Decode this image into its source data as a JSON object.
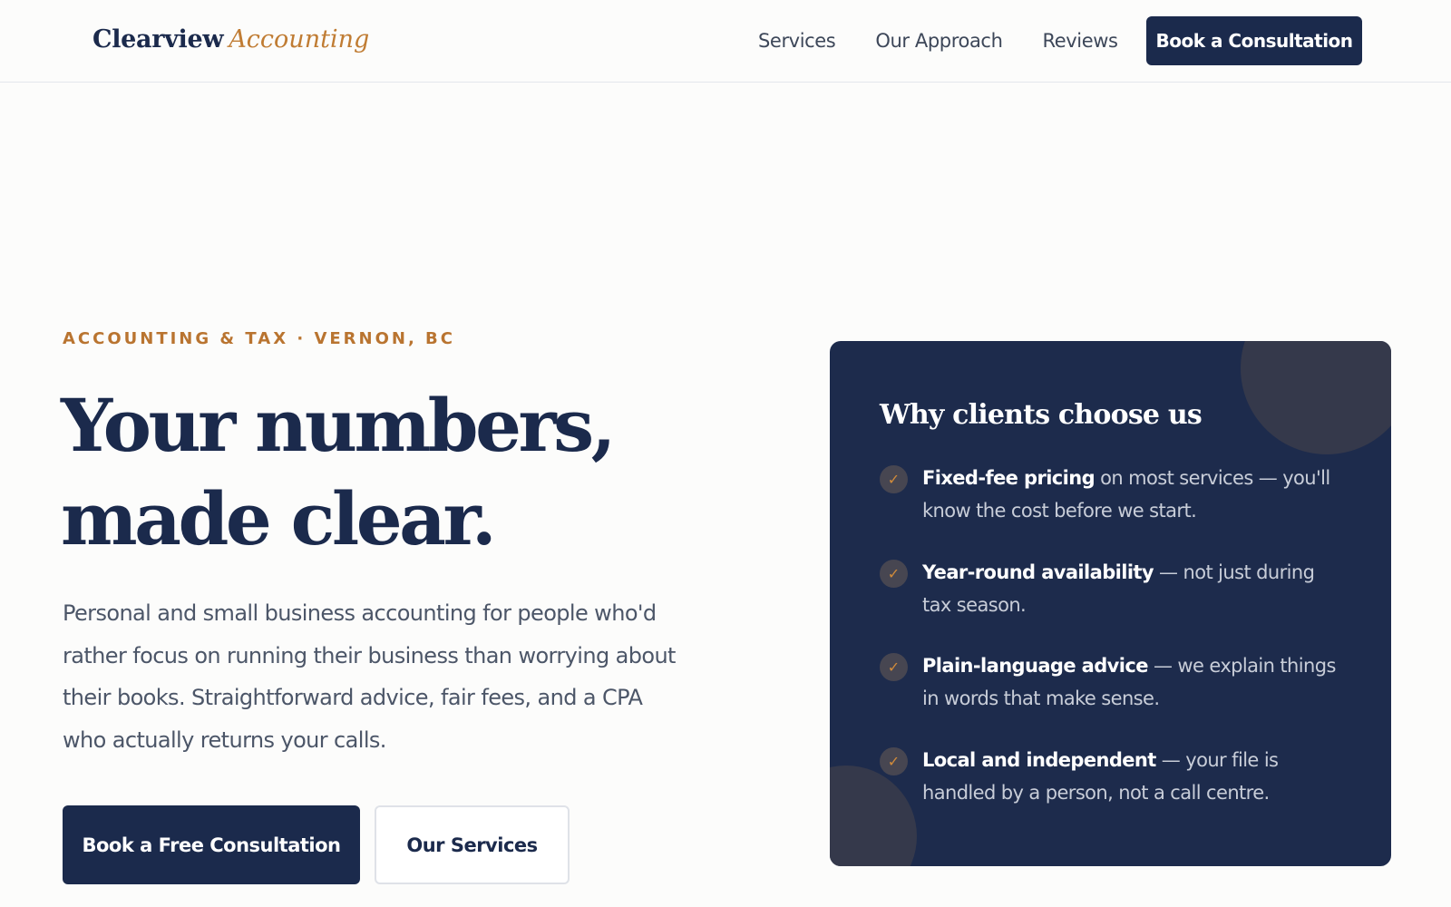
{
  "header": {
    "logo_main": "Clearview",
    "logo_accent": "Accounting",
    "nav": [
      {
        "label": "Services"
      },
      {
        "label": "Our Approach"
      },
      {
        "label": "Reviews"
      }
    ],
    "cta_label": "Book a Consultation"
  },
  "hero": {
    "eyebrow": "ACCOUNTING & TAX · VERNON, BC",
    "headline_line1": "Your numbers,",
    "headline_line2": "made clear.",
    "lede": "Personal and small business accounting for people who'd rather focus on running their business than worrying about their books. Straightforward advice, fair fees, and a CPA who actually returns your calls.",
    "primary_button": "Book a Free Consultation",
    "secondary_button": "Our Services"
  },
  "card": {
    "title": "Why clients choose us",
    "check_glyph": "✓",
    "reasons": [
      {
        "strong": "Fixed-fee pricing",
        "rest": " on most services — you'll know the cost before we start."
      },
      {
        "strong": "Year-round availability",
        "rest": " — not just during tax season."
      },
      {
        "strong": "Plain-language advice",
        "rest": " — we explain things in words that make sense."
      },
      {
        "strong": "Local and independent",
        "rest": " — your file is handled by a person, not a call centre."
      }
    ]
  },
  "colors": {
    "navy": "#1b2a4c",
    "accent": "#c07c33",
    "background": "#fcfcfb"
  }
}
